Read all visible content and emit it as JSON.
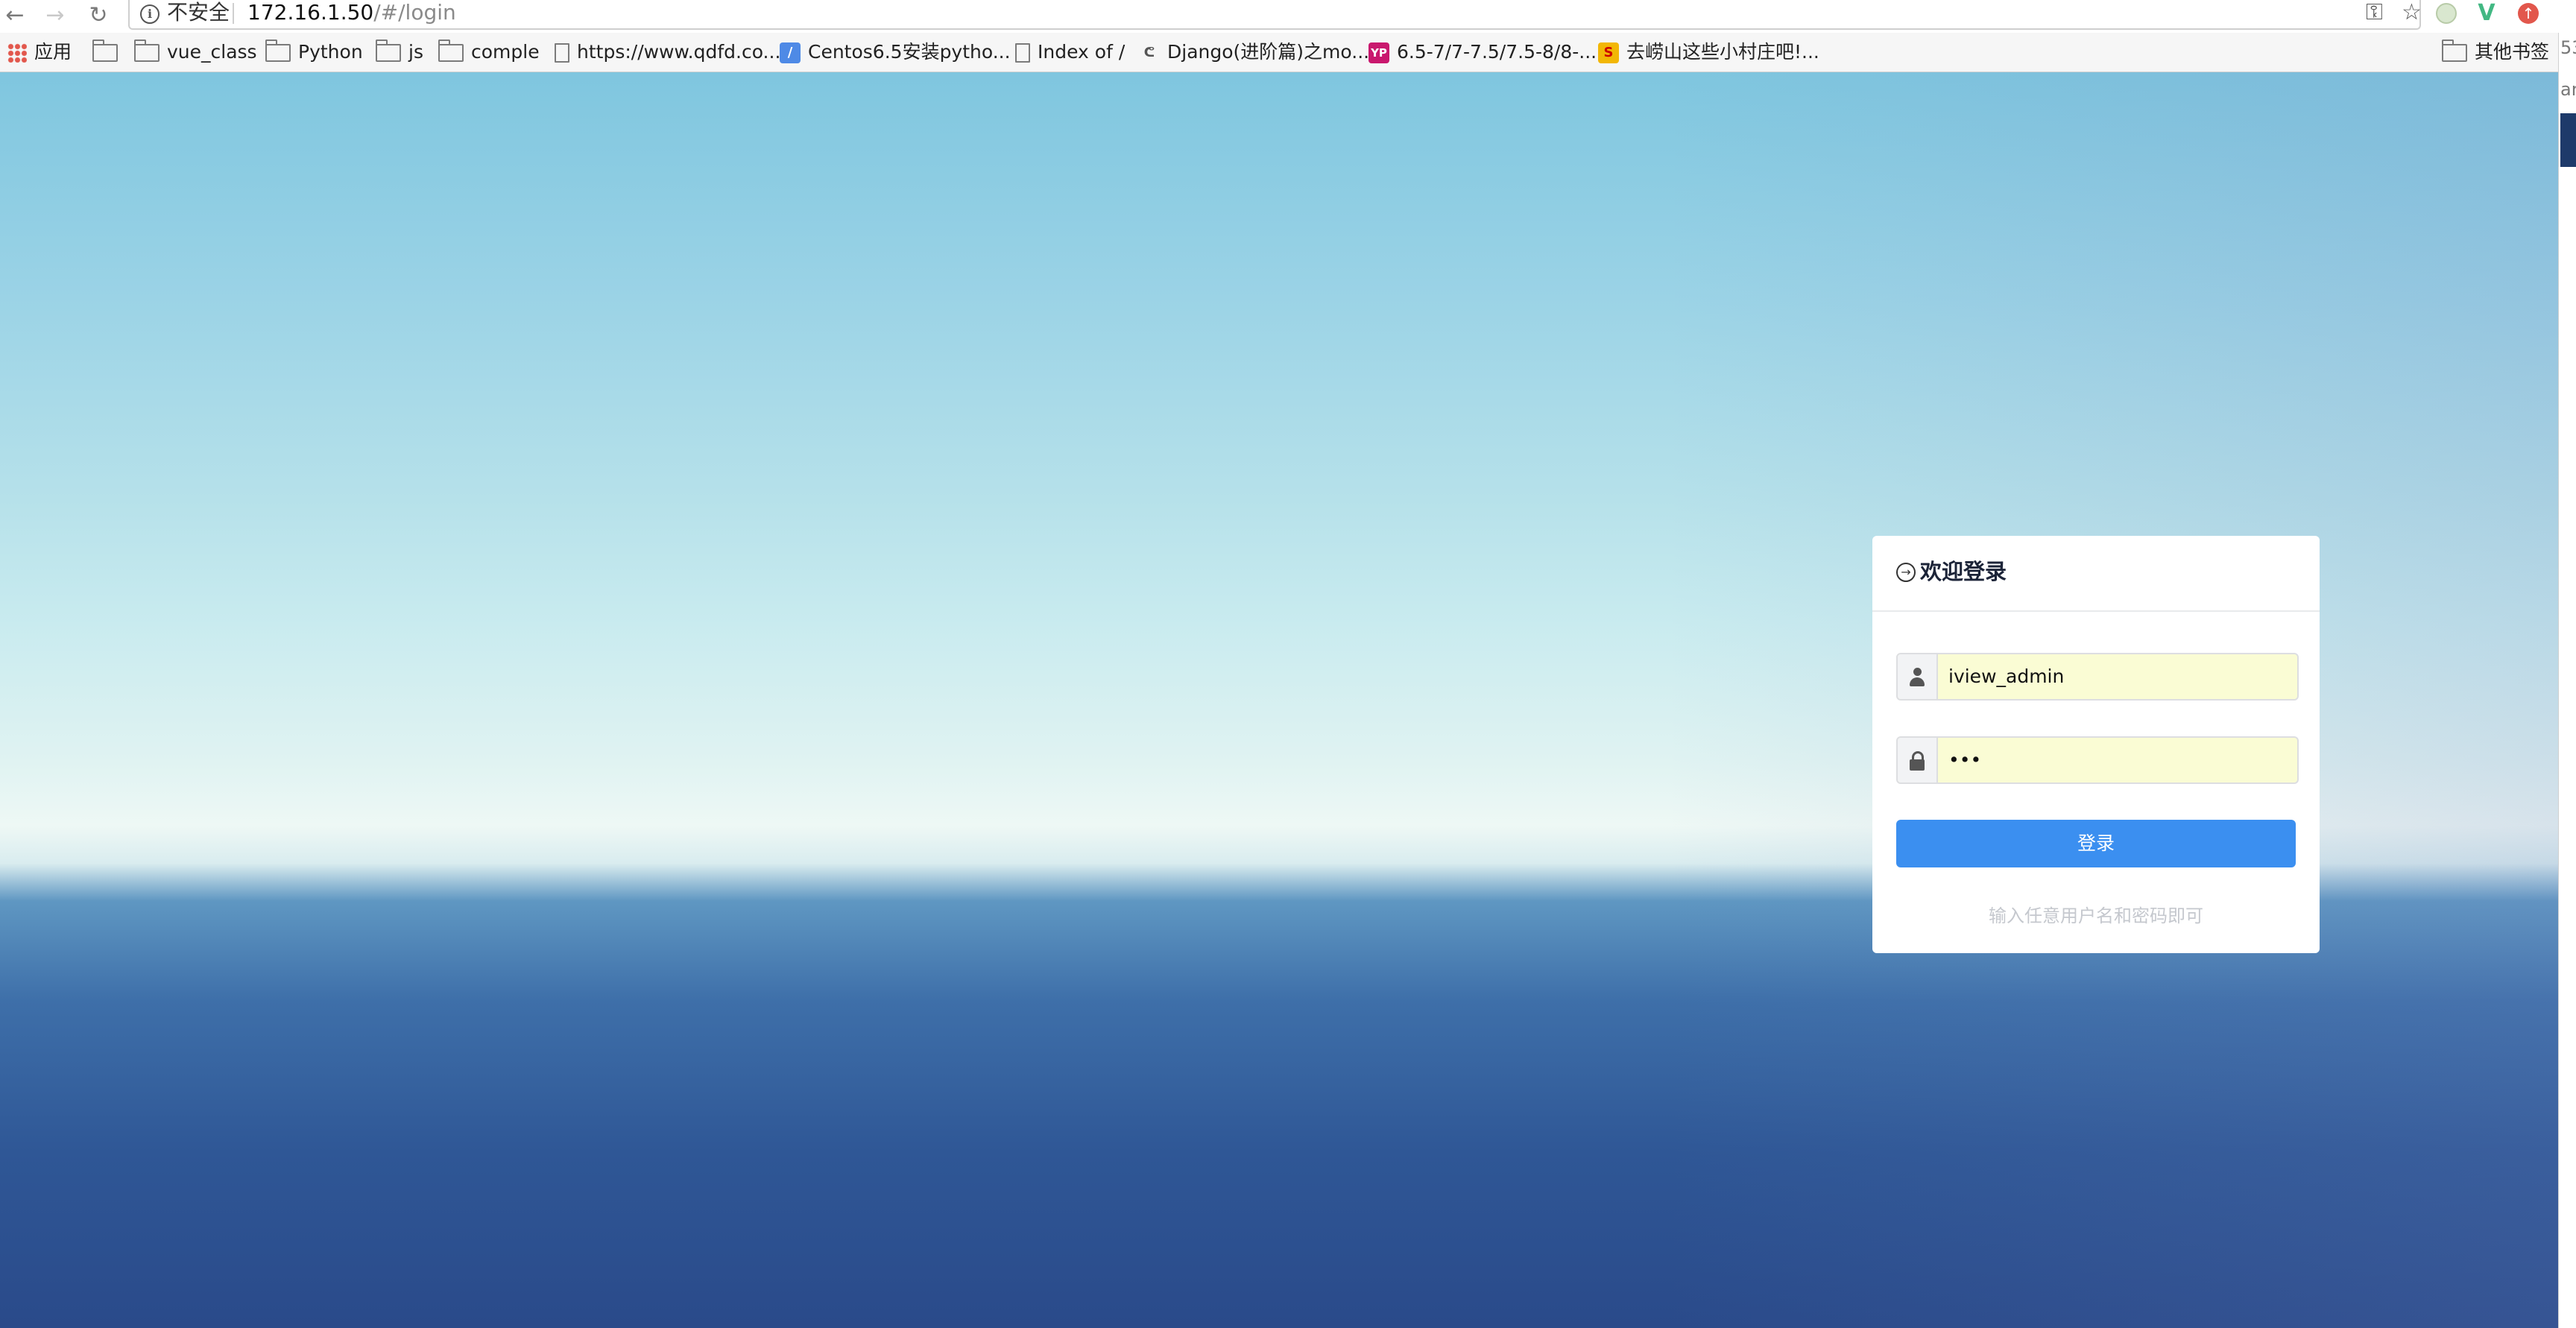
{
  "browser": {
    "security_label": "不安全",
    "url_host": "172.16.1.50",
    "url_path": "/#/login",
    "back_glyph": "←",
    "forward_glyph": "→",
    "reload_glyph": "↻",
    "key_glyph": "⚿",
    "star_glyph": "☆",
    "info_glyph": "i"
  },
  "bookmarks": {
    "apps": "应用",
    "items": [
      {
        "label": "",
        "icon": "folder-icon"
      },
      {
        "label": "vue_class",
        "icon": "folder-icon"
      },
      {
        "label": "Python",
        "icon": "folder-icon"
      },
      {
        "label": "js",
        "icon": "folder-icon"
      },
      {
        "label": "comple",
        "icon": "folder-icon"
      },
      {
        "label": "https://www.qdfd.co...",
        "icon": "page-icon"
      },
      {
        "label": "Centos6.5安装pytho...",
        "icon": "blog-icon"
      },
      {
        "label": "Index of /",
        "icon": "page-icon"
      },
      {
        "label": "Django(进阶篇)之mo...",
        "icon": "django-icon"
      },
      {
        "label": "6.5-7/7-7.5/7.5-8/8-...",
        "icon": "yp-icon"
      },
      {
        "label": "去崂山这些小村庄吧!...",
        "icon": "s-icon"
      }
    ],
    "other": "其他书签"
  },
  "edge": {
    "top_text": "53",
    "mid_text": "ar"
  },
  "login": {
    "title": "欢迎登录",
    "username": "iview_admin",
    "password_mask": "•••",
    "button": "登录",
    "hint": "输入任意用户名和密码即可"
  }
}
